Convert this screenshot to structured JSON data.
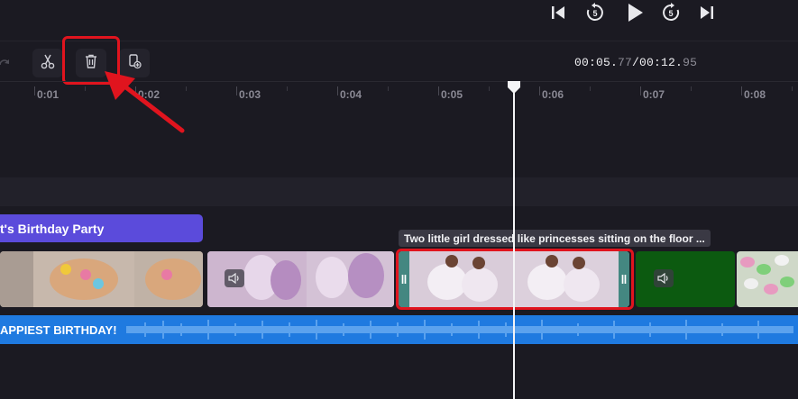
{
  "transport": {
    "icons": [
      "skip-back-icon",
      "rewind-5-icon",
      "play-icon",
      "forward-5-icon",
      "skip-forward-icon"
    ],
    "rewind_label": "5",
    "forward_label": "5"
  },
  "toolbar": {
    "icons": [
      "redo-icon",
      "split-scissors-icon",
      "delete-trash-icon",
      "duplicate-icon"
    ],
    "time_current_main": "00:05.",
    "time_current_frac": "77",
    "time_sep": "/",
    "time_total_main": "00:12.",
    "time_total_frac": "95"
  },
  "ruler": {
    "ticks": [
      "0:01",
      "0:02",
      "0:03",
      "0:04",
      "0:05",
      "0:06",
      "0:07",
      "0:08"
    ]
  },
  "timeline": {
    "title_clip_text": "t's Birthday Party",
    "tooltip_text": "Two little girl dressed like princesses sitting on the floor ...",
    "audio_label": "APPIEST BIRTHDAY!"
  },
  "colors": {
    "background": "#1b1a22",
    "title_clip": "#5b4bdb",
    "audio_track": "#1f7ae0",
    "highlight_red": "#e0141e",
    "green_clip": "#0c5a10"
  }
}
